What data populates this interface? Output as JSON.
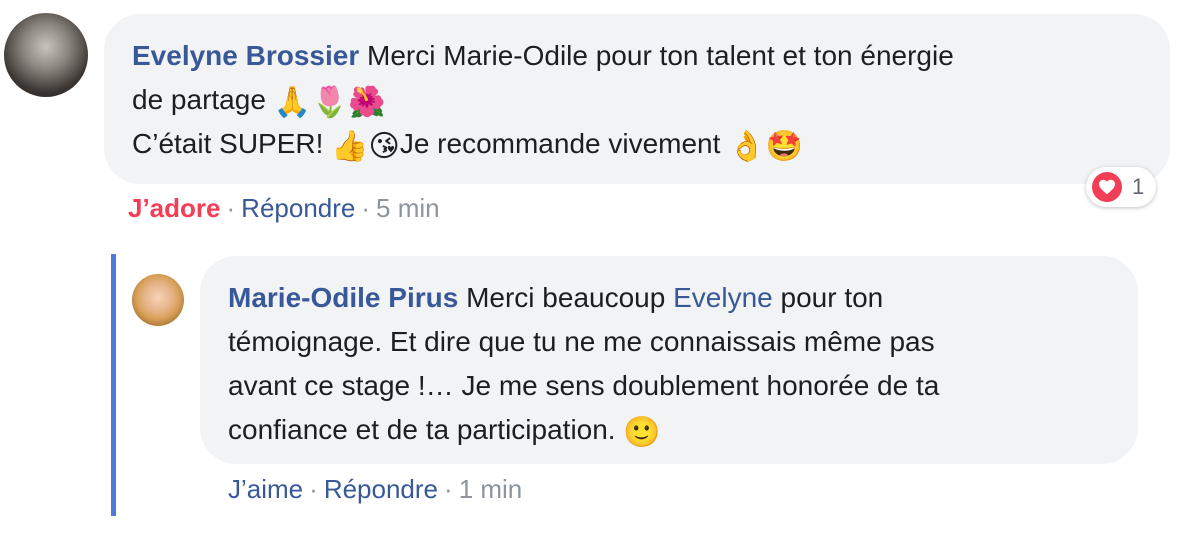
{
  "comments": [
    {
      "author": "Evelyne Brossier",
      "text_line1": "Merci Marie-Odile pour ton talent et ton énergie",
      "text_line2": "de partage",
      "emojis_line2": [
        "🙏",
        "🌷",
        "🌺"
      ],
      "text_line3_start": "C’était SUPER!",
      "emojis_line3a": [
        "👍",
        "😘"
      ],
      "text_line3_end": "Je recommande vivement",
      "emojis_line3b": [
        "👌",
        "🤩"
      ],
      "actions": {
        "reaction": "J’adore",
        "reply": "Répondre",
        "time": "5 min"
      },
      "reaction_badge": {
        "icon": "heart-icon",
        "count": "1"
      }
    },
    {
      "author": "Marie-Odile Pirus",
      "text_start": "Merci beaucoup",
      "mention": "Evelyne",
      "text_line1_end": "pour ton",
      "text_line2": "témoignage. Et dire que tu ne me connaissais même pas",
      "text_line3": "avant ce stage !… Je me sens doublement honorée de ta",
      "text_line4": "confiance et de ta participation.",
      "emoji_end": "🙂",
      "actions": {
        "like": "J’aime",
        "reply": "Répondre",
        "time": "1 min"
      }
    }
  ],
  "colors": {
    "link": "#385898",
    "love": "#f33e58",
    "bubble": "#f2f3f5",
    "meta": "#8d949e",
    "thread_line": "#4a7bd9"
  }
}
